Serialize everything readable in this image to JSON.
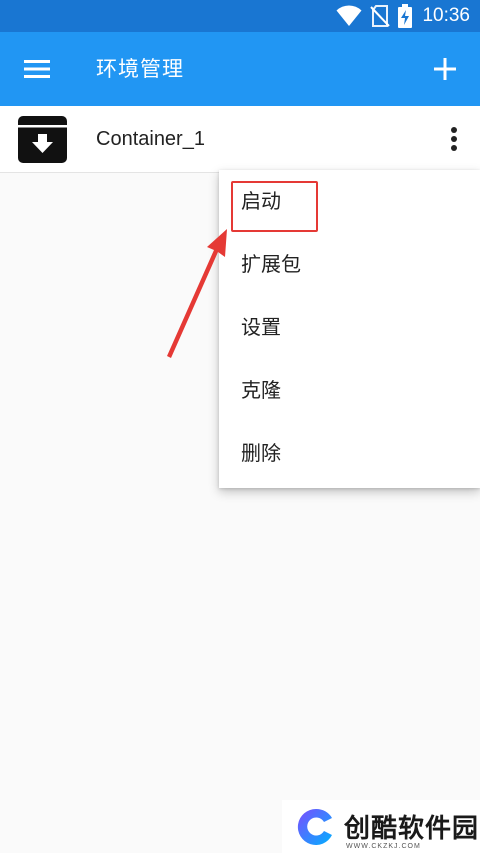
{
  "status_bar": {
    "time": "10:36",
    "icons": [
      "wifi-icon",
      "no-sim-icon",
      "battery-charging-icon"
    ]
  },
  "app_bar": {
    "title": "环境管理",
    "menu_icon": "hamburger-icon",
    "add_icon": "plus-icon"
  },
  "list": {
    "items": [
      {
        "label": "Container_1",
        "icon": "archive-download-icon",
        "more_icon": "more-vert-icon"
      }
    ]
  },
  "popup_menu": {
    "items": [
      {
        "label": "启动"
      },
      {
        "label": "扩展包"
      },
      {
        "label": "设置"
      },
      {
        "label": "克隆"
      },
      {
        "label": "删除"
      }
    ]
  },
  "annotation": {
    "color": "#e53935",
    "target": "启动"
  },
  "watermark": {
    "text": "创酷软件园",
    "url": "WWW.CKZKJ.COM"
  },
  "colors": {
    "status_bar": "#1976d2",
    "app_bar": "#2196f3",
    "background": "#fafafa"
  }
}
